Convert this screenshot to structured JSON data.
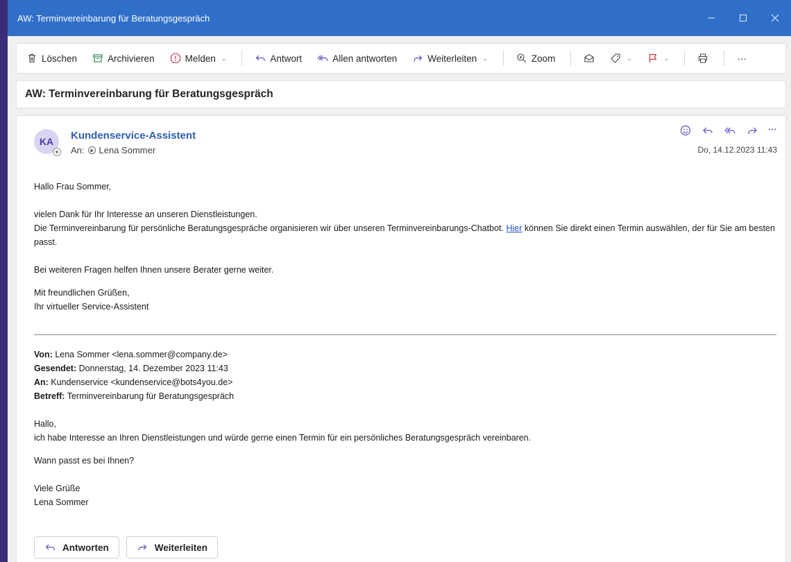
{
  "window": {
    "title": "AW: Terminvereinbarung für Beratungsgespräch"
  },
  "toolbar": {
    "delete": "Löschen",
    "archive": "Archivieren",
    "report": "Melden",
    "reply": "Antwort",
    "reply_all": "Allen antworten",
    "forward": "Weiterleiten",
    "zoom": "Zoom",
    "more": "···"
  },
  "subject": "AW: Terminvereinbarung für Beratungsgespräch",
  "message": {
    "avatar_initials": "KA",
    "sender": "Kundenservice-Assistent",
    "to_label": "An:",
    "to_name": "Lena Sommer",
    "date": "Do, 14.12.2023 11:43",
    "more": "···",
    "greeting": "Hallo Frau Sommer,",
    "line1": "vielen Dank für Ihr Interesse an unseren Dienstleistungen.",
    "line2_pre": "Die Terminvereinbarung für persönliche Beratungsgespräche organisieren wir über unseren Terminvereinbarungs-Chatbot. ",
    "link_text": "Hier",
    "line2_post": " können Sie direkt einen Termin auswählen, der für Sie am besten passt.",
    "line3": "Bei weiteren Fragen helfen Ihnen unsere Berater gerne weiter.",
    "closing": "Mit freundlichen Grüßen,",
    "signature": "Ihr virtueller Service-Assistent"
  },
  "quoted": {
    "from_label": "Von:",
    "from_value": " Lena Sommer <lena.sommer@company.de>",
    "sent_label": "Gesendet:",
    "sent_value": " Donnerstag, 14. Dezember 2023 11:43",
    "to_label": "An:",
    "to_value": " Kundenservice <kundenservice@bots4you.de>",
    "subject_label": "Betreff:",
    "subject_value": " Terminvereinbarung für Beratungsgespräch",
    "greeting": "Hallo,",
    "line1": "ich habe Interesse an Ihren Dienstleistungen und würde gerne einen Termin für ein persönliches Beratungsgespräch vereinbaren.",
    "line2": "Wann passt es bei Ihnen?",
    "closing": "Viele Grüße",
    "signature": "Lena Sommer"
  },
  "reply_buttons": {
    "reply": "Antworten",
    "forward": "Weiterleiten"
  },
  "colors": {
    "titlebar": "#2f6fc9",
    "accent": "#2f5eb0",
    "flag": "#d13438",
    "report": "#c4314b",
    "archive": "#107c41"
  }
}
